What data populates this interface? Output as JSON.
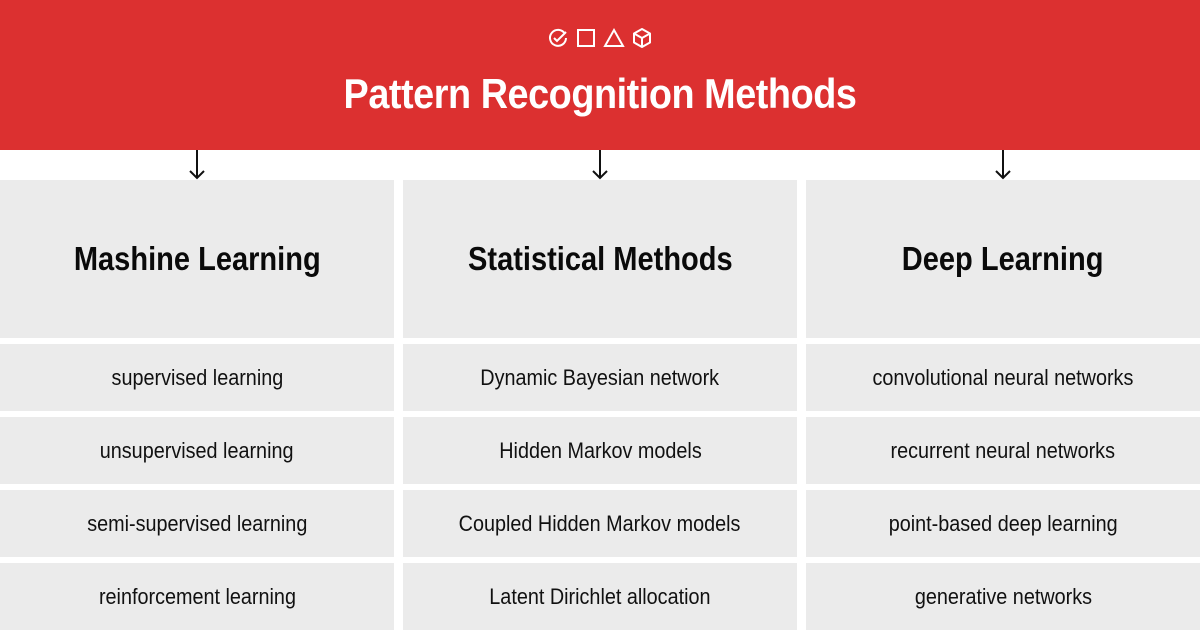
{
  "banner": {
    "title": "Pattern Recognition Methods",
    "icons": [
      "check-circle-icon",
      "square-icon",
      "triangle-icon",
      "cube-icon"
    ],
    "background_color": "#dc3030"
  },
  "columns": [
    {
      "heading": "Mashine Learning",
      "items": [
        "supervised learning",
        "unsupervised learning",
        "semi-supervised learning",
        "reinforcement learning"
      ]
    },
    {
      "heading": "Statistical Methods",
      "items": [
        "Dynamic Bayesian network",
        "Hidden Markov models",
        "Coupled Hidden Markov models",
        "Latent Dirichlet allocation"
      ]
    },
    {
      "heading": "Deep Learning",
      "items": [
        "convolutional neural networks",
        "recurrent neural networks",
        "point-based deep learning",
        "generative networks"
      ]
    }
  ],
  "colors": {
    "cell": "#ebebeb",
    "text": "#111111"
  }
}
